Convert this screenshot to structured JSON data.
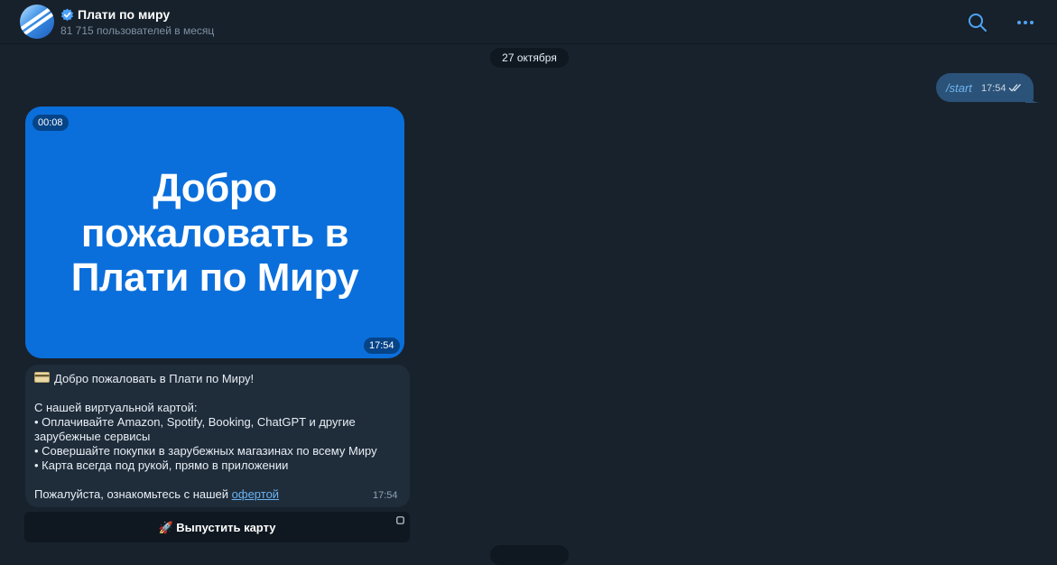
{
  "header": {
    "title": "Плати по миру",
    "subtitle": "81 715 пользователей в месяц"
  },
  "chat": {
    "date_label": "27 октября",
    "outgoing": {
      "text": "/start",
      "time": "17:54"
    },
    "video": {
      "duration": "00:08",
      "time": "17:54",
      "lines": [
        "Добро",
        "пожаловать в",
        "Плати по Миру"
      ]
    },
    "message": {
      "greeting": "Добро пожаловать в Плати по Миру!",
      "intro": "С нашей виртуальной картой:",
      "bullets": [
        "• Оплачивайте Amazon, Spotify, Booking, ChatGPT и другие",
        "зарубежные сервисы",
        "• Совершайте покупки в зарубежных магазинах по всему Миру",
        "• Карта всегда под рукой, прямо в приложении"
      ],
      "footer_prefix": "Пожалуйста, ознакомьтесь с нашей ",
      "footer_link": "офертой",
      "time": "17:54"
    },
    "keyboard_button": "🚀 Выпустить карту"
  },
  "colors": {
    "background": "#18222d",
    "video_blue": "#0a6fdb",
    "outgoing_bubble": "#2b5278",
    "accent": "#6ab3f3"
  },
  "icons": [
    "avatar",
    "verified-badge-icon",
    "search-icon",
    "more-icon",
    "read-check-icon",
    "card-icon",
    "inline-button-corner-icon"
  ]
}
